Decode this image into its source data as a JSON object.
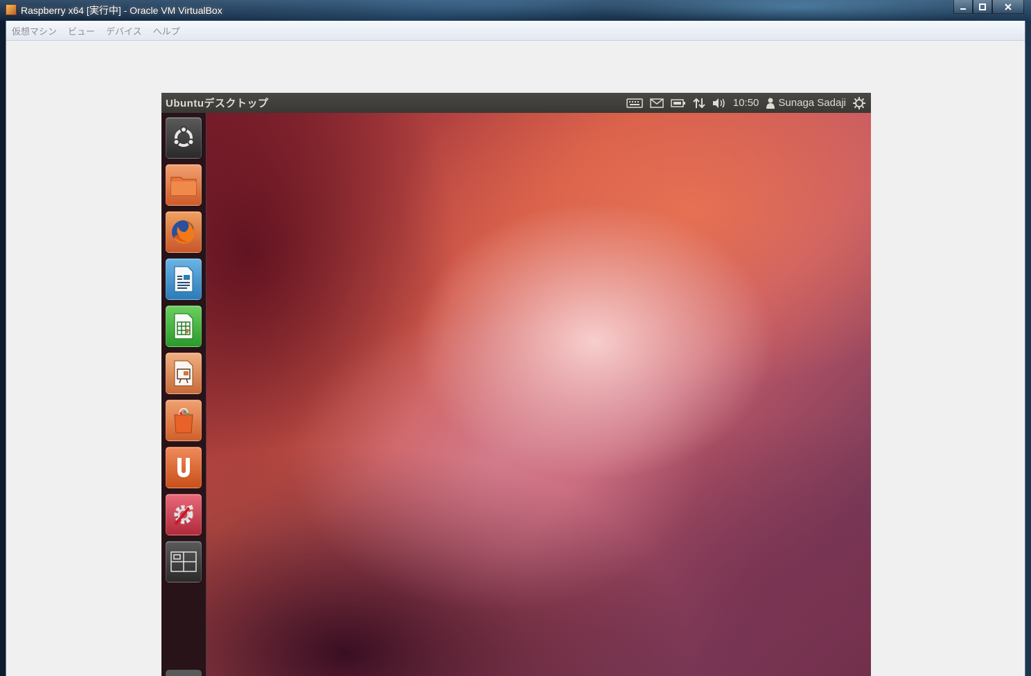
{
  "host_window": {
    "title": "Raspberry x64 [実行中] - Oracle VM VirtualBox",
    "controls": {
      "minimize": "‒",
      "maximize": "□",
      "close": "X"
    }
  },
  "menubar": {
    "items": [
      {
        "label": "仮想マシン"
      },
      {
        "label": "ビュー"
      },
      {
        "label": "デバイス"
      },
      {
        "label": "ヘルプ"
      }
    ]
  },
  "guest": {
    "panel": {
      "title": "Ubuntuデスクトップ",
      "clock": "10:50",
      "user": "Sunaga Sadaji"
    },
    "launcher": {
      "items": [
        {
          "name": "dash-home",
          "icon": "ubuntu-logo-icon",
          "color": "#3a3a3a"
        },
        {
          "name": "files",
          "icon": "folder-icon",
          "color": "#e06a3a"
        },
        {
          "name": "firefox",
          "icon": "firefox-icon",
          "color": "#d85a2a"
        },
        {
          "name": "libreoffice-writer",
          "icon": "writer-icon",
          "color": "#2d8fc8"
        },
        {
          "name": "libreoffice-calc",
          "icon": "calc-icon",
          "color": "#3fa53a"
        },
        {
          "name": "libreoffice-impress",
          "icon": "impress-icon",
          "color": "#d8733a"
        },
        {
          "name": "software-center",
          "icon": "shopping-bag-icon",
          "color": "#e0763a"
        },
        {
          "name": "ubuntu-one",
          "icon": "ubuntu-one-icon",
          "color": "#d9602a"
        },
        {
          "name": "system-settings",
          "icon": "settings-icon",
          "color": "#c8384a"
        },
        {
          "name": "workspace-switcher",
          "icon": "workspaces-icon",
          "color": "#3c3c3c"
        }
      ]
    }
  }
}
